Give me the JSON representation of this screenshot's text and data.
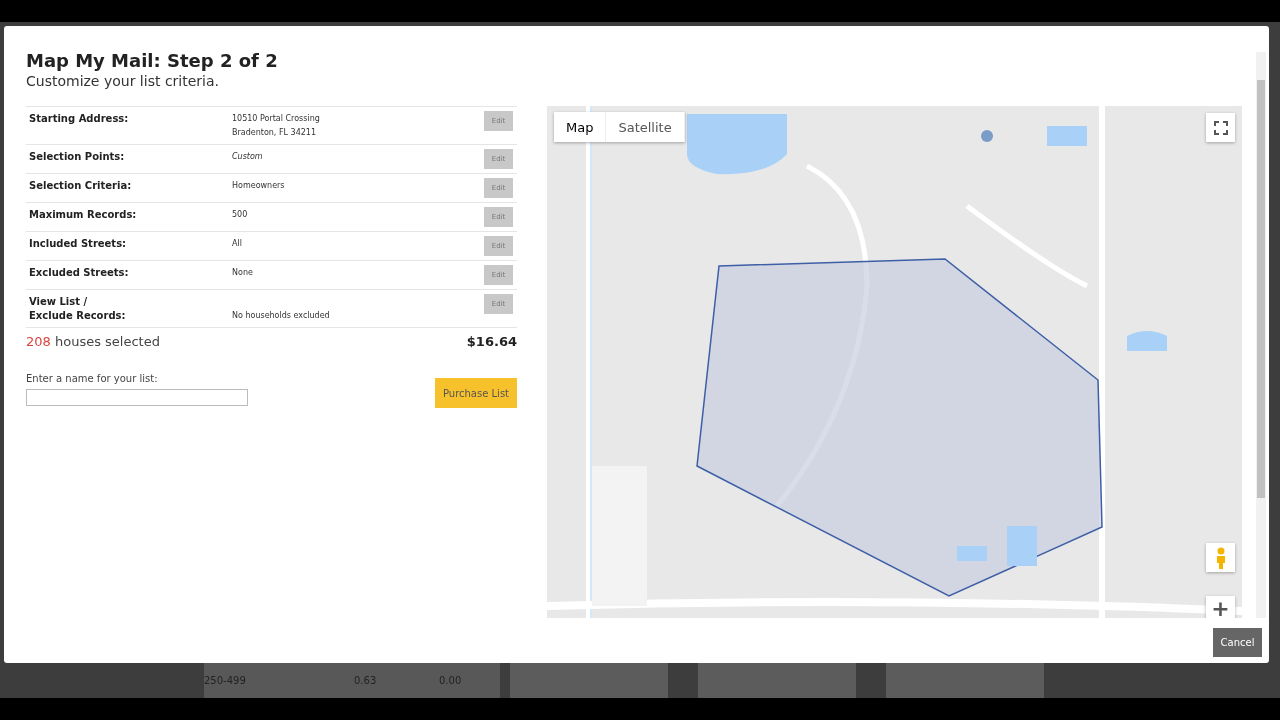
{
  "dialog": {
    "title": "Map My Mail: Step 2 of 2",
    "subtitle": "Customize your list criteria.",
    "criteria": [
      {
        "label": "Starting Address:",
        "value_lines": [
          "10510 Portal Crossing",
          "Bradenton, FL 34211"
        ],
        "italic": false,
        "action": "Edit"
      },
      {
        "label": "Selection Points:",
        "value_lines": [
          "Custom"
        ],
        "italic": true,
        "action": "Edit"
      },
      {
        "label": "Selection Criteria:",
        "value_lines": [
          "Homeowners"
        ],
        "italic": false,
        "action": "Edit"
      },
      {
        "label": "Maximum Records:",
        "value_lines": [
          "500"
        ],
        "italic": false,
        "action": "Edit"
      },
      {
        "label": "Included Streets:",
        "value_lines": [
          "All"
        ],
        "italic": false,
        "action": "Edit"
      },
      {
        "label": "Excluded Streets:",
        "value_lines": [
          "None"
        ],
        "italic": false,
        "action": "Edit"
      },
      {
        "label_lines": [
          "View List /",
          "Exclude Records:"
        ],
        "value_lines": [
          "No households excluded"
        ],
        "italic": false,
        "action": "Edit"
      }
    ],
    "count": "208",
    "count_label": "houses selected",
    "price": "$16.64",
    "name_field": {
      "label": "Enter a name for your list:"
    },
    "purchase_button": "Purchase List",
    "map": {
      "kind": "picture",
      "type_buttons": [
        {
          "label": "Map",
          "selected": true
        },
        {
          "label": "Satellite",
          "selected": false
        }
      ],
      "zoom_in": "+"
    },
    "cancel_button": "Cancel"
  },
  "background": {
    "row": [
      "250-499",
      "0.63",
      "0.00"
    ],
    "cards": [
      {
        "kind": "postcard"
      },
      {
        "kind": "postcard"
      },
      {
        "kind": "postcard"
      }
    ]
  }
}
